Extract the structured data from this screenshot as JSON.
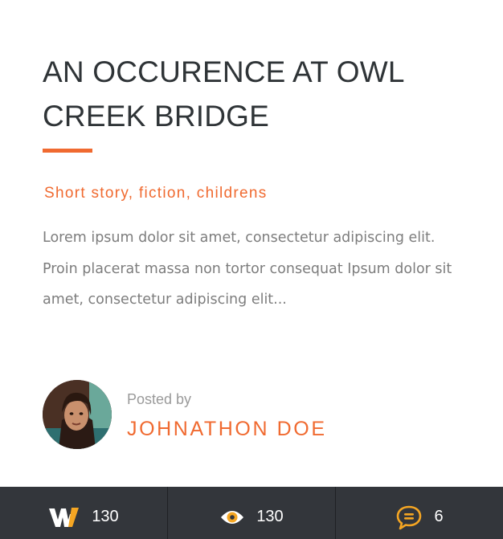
{
  "post": {
    "title": "AN OCCURENCE AT OWL CREEK BRIDGE",
    "tags": "Short story, fiction, childrens",
    "excerpt": "Lorem ipsum dolor sit amet, consectetur adipiscing elit. Proin placerat massa non tortor consequat Ipsum dolor sit amet, consectetur adipiscing elit...",
    "posted_by_label": "Posted by",
    "author": "JOHNATHON DOE"
  },
  "stats": {
    "w_count": "130",
    "views": "130",
    "comments": "6"
  },
  "icons": {
    "w": "w-logo-icon",
    "views": "eye-icon",
    "comments": "speech-bubble-icon"
  },
  "colors": {
    "accent": "#f06a30",
    "icon_accent": "#f5a623",
    "title": "#2f3437",
    "body_text": "#7d7d7d",
    "footer_bg": "#33363b"
  }
}
